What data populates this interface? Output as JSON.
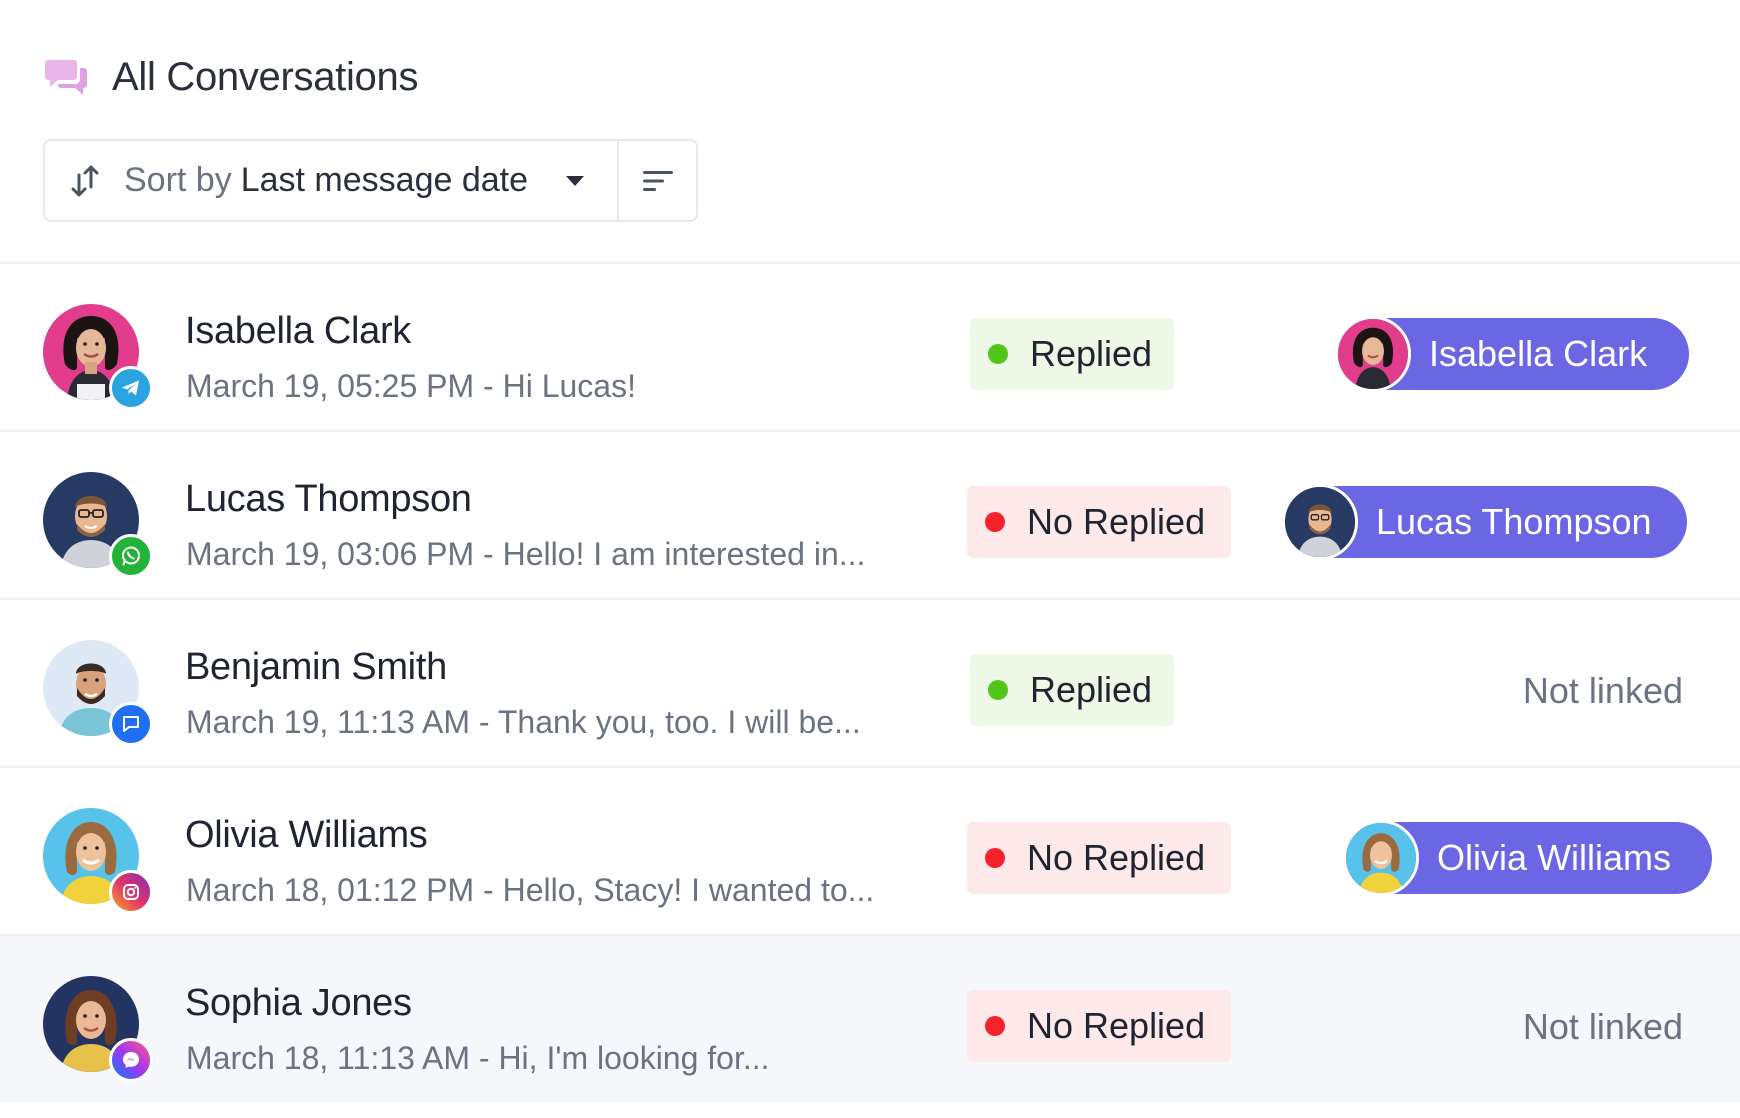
{
  "header": {
    "title": "All Conversations",
    "icon": "chat-bubbles-icon"
  },
  "toolbar": {
    "sort_prefix": "Sort by",
    "sort_value": "Last message date",
    "sort_icon": "sort-arrows-icon",
    "filter_icon": "filter-lines-icon"
  },
  "conversations": [
    {
      "name": "Isabella Clark",
      "preview": "March 19, 05:25 PM - Hi Lucas!",
      "channel": "telegram-icon",
      "channel_color": "#2aa3e0",
      "status": "Replied",
      "linked_name": "Isabella Clark"
    },
    {
      "name": "Lucas Thompson",
      "preview": "March 19, 03:06 PM - Hello! I am interested in...",
      "channel": "whatsapp-icon",
      "channel_color": "#23b33a",
      "status": "No Replied",
      "linked_name": "Lucas Thompson"
    },
    {
      "name": "Benjamin Smith",
      "preview": "March 19, 11:13 AM - Thank you, too. I will be...",
      "channel": "chat-message-icon",
      "channel_color": "#1f6ff2",
      "status": "Replied",
      "linked_text": "Not linked"
    },
    {
      "name": "Olivia Williams",
      "preview": "March 18, 01:12 PM - Hello, Stacy! I wanted to...",
      "channel": "instagram-icon",
      "channel_color": "#e1306c",
      "status": "No Replied",
      "linked_name": "Olivia Williams"
    },
    {
      "name": "Sophia Jones",
      "preview": "March 18, 11:13 AM - Hi, I'm looking for...",
      "channel": "messenger-icon",
      "channel_color": "#a335ee",
      "status": "No Replied",
      "linked_text": "Not linked"
    }
  ],
  "colors": {
    "accent": "#6b66e3",
    "replied_bg": "#eef8e6",
    "replied_dot": "#52c41a",
    "noreplied_bg": "#fde9ea",
    "noreplied_dot": "#f5222d"
  }
}
